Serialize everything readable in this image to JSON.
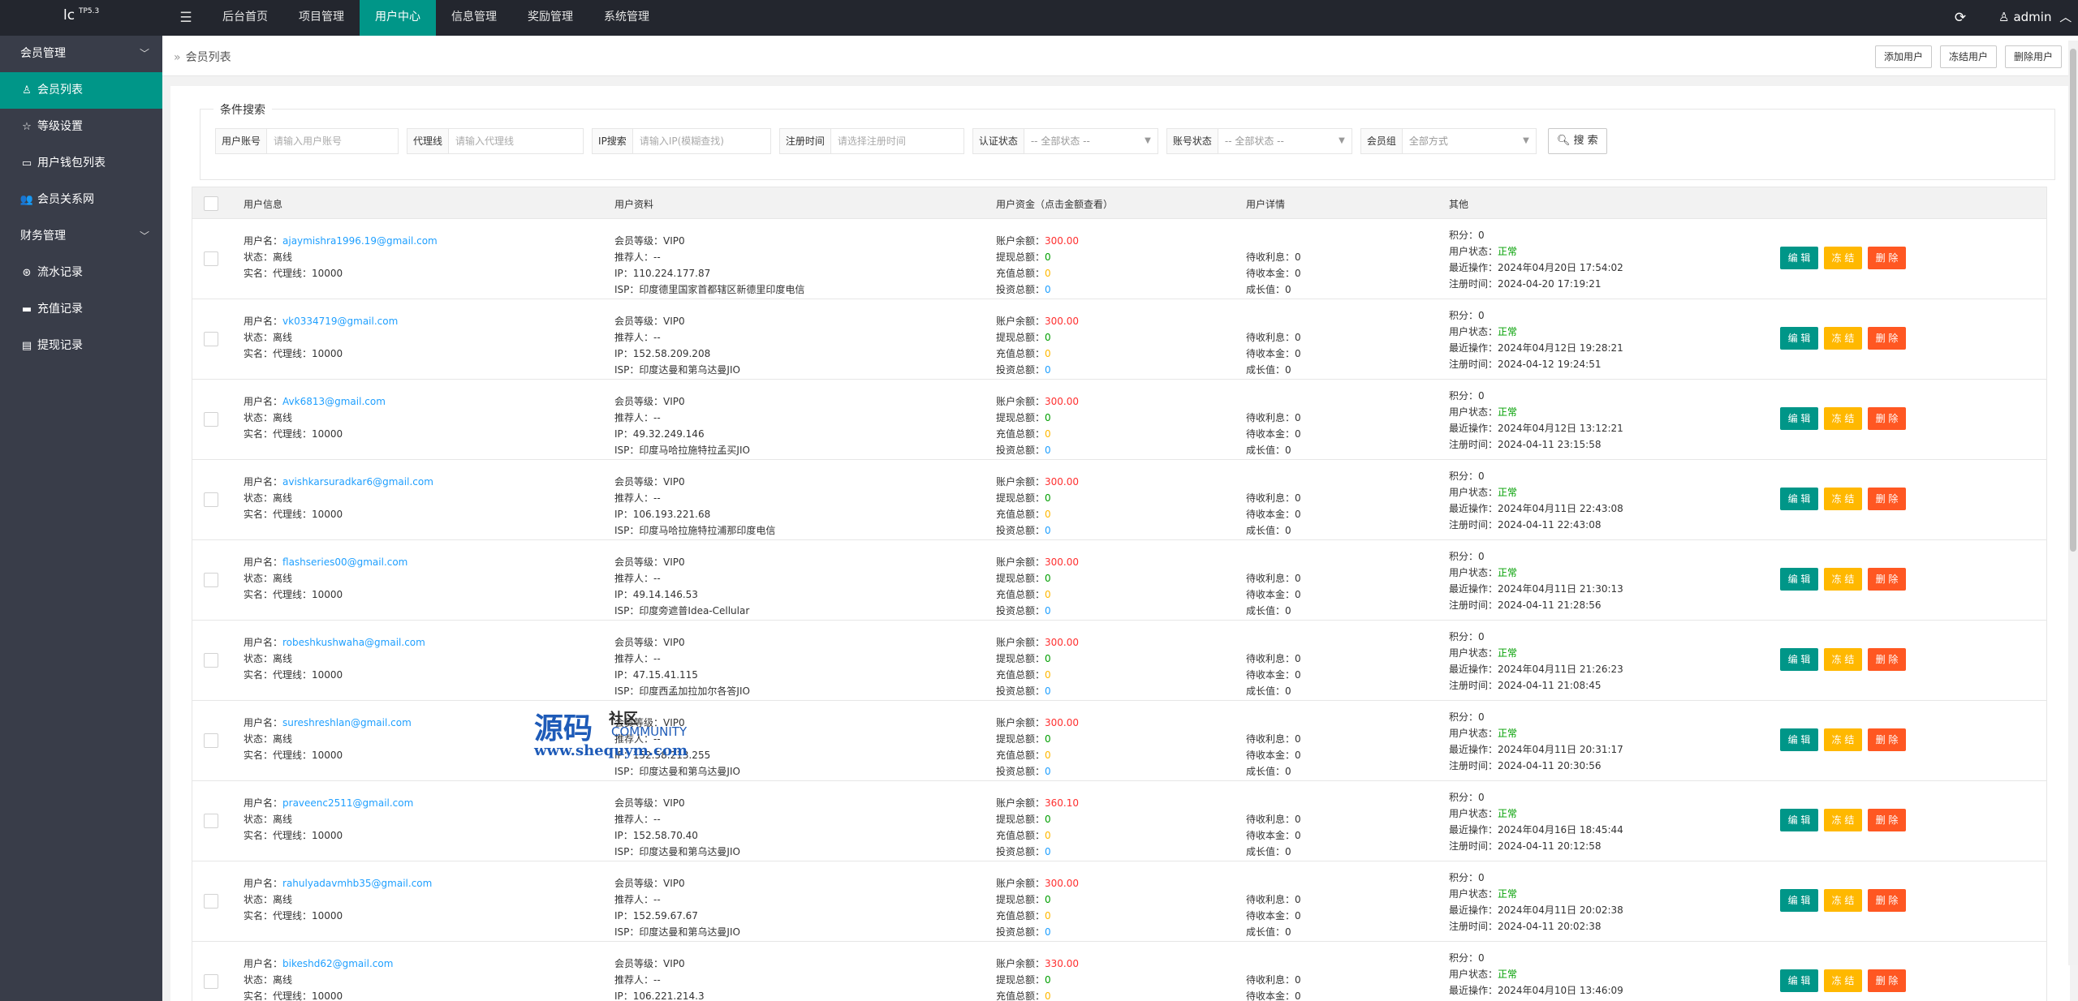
{
  "app": {
    "logo_main": "lc",
    "logo_sup": "TP5.3",
    "menu_toggle_icon": "hamburger-icon",
    "refresh_icon": "refresh-icon",
    "user": "admin"
  },
  "topnav": [
    {
      "label": "后台首页"
    },
    {
      "label": "项目管理"
    },
    {
      "label": "用户中心",
      "active": true
    },
    {
      "label": "信息管理"
    },
    {
      "label": "奖励管理"
    },
    {
      "label": "系统管理"
    }
  ],
  "sidebar": {
    "group1": "会员管理",
    "items1": [
      {
        "label": "会员列表",
        "icon": "user-icon",
        "glyph": "♙",
        "active": true
      },
      {
        "label": "等级设置",
        "icon": "star-icon",
        "glyph": "☆"
      },
      {
        "label": "用户钱包列表",
        "icon": "wallet-icon",
        "glyph": "▭"
      },
      {
        "label": "会员关系网",
        "icon": "users-icon",
        "glyph": "👥"
      }
    ],
    "group2": "财务管理",
    "items2": [
      {
        "label": "流水记录",
        "icon": "flow-icon",
        "glyph": "⊛"
      },
      {
        "label": "充值记录",
        "icon": "card-icon",
        "glyph": "▬"
      },
      {
        "label": "提现记录",
        "icon": "withdraw-icon",
        "glyph": "▤"
      }
    ]
  },
  "breadcrumb": {
    "sep": "»",
    "label": "会员列表"
  },
  "actions": {
    "add": "添加用户",
    "freeze": "冻结用户",
    "delete": "删除用户"
  },
  "search": {
    "legend": "条件搜索",
    "fields": [
      {
        "label": "用户账号",
        "placeholder": "请输入用户账号",
        "type": "input",
        "w": 162
      },
      {
        "label": "代理线",
        "placeholder": "请输入代理线",
        "type": "input",
        "w": 166
      },
      {
        "label": "IP搜索",
        "placeholder": "请输入IP(模糊查找)",
        "type": "input",
        "w": 170
      },
      {
        "label": "注册时间",
        "placeholder": "请选择注册时间",
        "type": "input",
        "w": 164
      },
      {
        "label": "认证状态",
        "placeholder": "-- 全部状态 --",
        "type": "select",
        "w": 165
      },
      {
        "label": "账号状态",
        "placeholder": "-- 全部状态 --",
        "type": "select",
        "w": 165
      },
      {
        "label": "会员组",
        "placeholder": "全部方式",
        "type": "select",
        "w": 165
      }
    ],
    "button": "搜 索"
  },
  "table": {
    "headers": [
      "用户信息",
      "用户资料",
      "用户资金（点击金额查看）",
      "用户详情",
      "其他"
    ],
    "labels": {
      "username": "用户名：",
      "status": "状态：",
      "realname": "实名：",
      "level": "会员等级：",
      "referrer": "推荐人：",
      "ip": "IP：",
      "isp": "ISP：",
      "balance": "账户余额：",
      "withdraw": "提现总额：",
      "recharge": "充值总额：",
      "invest": "投资总额：",
      "pend_interest": "待收利息：",
      "pend_principal": "待收本金：",
      "growth": "成长值：",
      "points": "积分：",
      "ustatus": "用户状态：",
      "lastop": "最近操作：",
      "regtime": "注册时间："
    },
    "btn_edit": "编 辑",
    "btn_freeze": "冻 结",
    "btn_delete": "删 除",
    "rows": [
      {
        "username": "ajaymishra1996.19@gmail.com",
        "status": "离线",
        "realname": "代理线：10000",
        "level": "VIP0",
        "referrer": "--",
        "ip": "110.224.177.87",
        "isp": "印度德里国家首都辖区新德里印度电信",
        "balance": "300.00",
        "withdraw": "0",
        "recharge": "0",
        "invest": "0",
        "pend_interest": "0",
        "pend_principal": "0",
        "growth": "0",
        "points": "0",
        "ustatus": "正常",
        "lastop": "2024年04月20日 17:54:02",
        "regtime": "2024-04-20 17:19:21"
      },
      {
        "username": "vk0334719@gmail.com",
        "status": "离线",
        "realname": "代理线：10000",
        "level": "VIP0",
        "referrer": "--",
        "ip": "152.58.209.208",
        "isp": "印度达曼和第乌达曼JIO",
        "balance": "300.00",
        "withdraw": "0",
        "recharge": "0",
        "invest": "0",
        "pend_interest": "0",
        "pend_principal": "0",
        "growth": "0",
        "points": "0",
        "ustatus": "正常",
        "lastop": "2024年04月12日 19:28:21",
        "regtime": "2024-04-12 19:24:51"
      },
      {
        "username": "Avk6813@gmail.com",
        "status": "离线",
        "realname": "代理线：10000",
        "level": "VIP0",
        "referrer": "--",
        "ip": "49.32.249.146",
        "isp": "印度马哈拉施特拉孟买JIO",
        "balance": "300.00",
        "withdraw": "0",
        "recharge": "0",
        "invest": "0",
        "pend_interest": "0",
        "pend_principal": "0",
        "growth": "0",
        "points": "0",
        "ustatus": "正常",
        "lastop": "2024年04月12日 13:12:21",
        "regtime": "2024-04-11 23:15:58"
      },
      {
        "username": "avishkarsuradkar6@gmail.com",
        "status": "离线",
        "realname": "代理线：10000",
        "level": "VIP0",
        "referrer": "--",
        "ip": "106.193.221.68",
        "isp": "印度马哈拉施特拉浦那印度电信",
        "balance": "300.00",
        "withdraw": "0",
        "recharge": "0",
        "invest": "0",
        "pend_interest": "0",
        "pend_principal": "0",
        "growth": "0",
        "points": "0",
        "ustatus": "正常",
        "lastop": "2024年04月11日 22:43:08",
        "regtime": "2024-04-11 22:43:08"
      },
      {
        "username": "flashseries00@gmail.com",
        "status": "离线",
        "realname": "代理线：10000",
        "level": "VIP0",
        "referrer": "--",
        "ip": "49.14.146.53",
        "isp": "印度旁遮普Idea-Cellular",
        "balance": "300.00",
        "withdraw": "0",
        "recharge": "0",
        "invest": "0",
        "pend_interest": "0",
        "pend_principal": "0",
        "growth": "0",
        "points": "0",
        "ustatus": "正常",
        "lastop": "2024年04月11日 21:30:13",
        "regtime": "2024-04-11 21:28:56"
      },
      {
        "username": "robeshkushwaha@gmail.com",
        "status": "离线",
        "realname": "代理线：10000",
        "level": "VIP0",
        "referrer": "--",
        "ip": "47.15.41.115",
        "isp": "印度西孟加拉加尔各答JIO",
        "balance": "300.00",
        "withdraw": "0",
        "recharge": "0",
        "invest": "0",
        "pend_interest": "0",
        "pend_principal": "0",
        "growth": "0",
        "points": "0",
        "ustatus": "正常",
        "lastop": "2024年04月11日 21:26:23",
        "regtime": "2024-04-11 21:08:45"
      },
      {
        "username": "sureshreshlan@gmail.com",
        "status": "离线",
        "realname": "代理线：10000",
        "level": "VIP0",
        "referrer": "--",
        "ip": "152.58.213.255",
        "isp": "印度达曼和第乌达曼JIO",
        "balance": "300.00",
        "withdraw": "0",
        "recharge": "0",
        "invest": "0",
        "pend_interest": "0",
        "pend_principal": "0",
        "growth": "0",
        "points": "0",
        "ustatus": "正常",
        "lastop": "2024年04月11日 20:31:17",
        "regtime": "2024-04-11 20:30:56"
      },
      {
        "username": "praveenc2511@gmail.com",
        "status": "离线",
        "realname": "代理线：10000",
        "level": "VIP0",
        "referrer": "--",
        "ip": "152.58.70.40",
        "isp": "印度达曼和第乌达曼JIO",
        "balance": "360.10",
        "withdraw": "0",
        "recharge": "0",
        "invest": "0",
        "pend_interest": "0",
        "pend_principal": "0",
        "growth": "0",
        "points": "0",
        "ustatus": "正常",
        "lastop": "2024年04月16日 18:45:44",
        "regtime": "2024-04-11 20:12:58"
      },
      {
        "username": "rahulyadavmhb35@gmail.com",
        "status": "离线",
        "realname": "代理线：10000",
        "level": "VIP0",
        "referrer": "--",
        "ip": "152.59.67.67",
        "isp": "印度达曼和第乌达曼JIO",
        "balance": "300.00",
        "withdraw": "0",
        "recharge": "0",
        "invest": "0",
        "pend_interest": "0",
        "pend_principal": "0",
        "growth": "0",
        "points": "0",
        "ustatus": "正常",
        "lastop": "2024年04月11日 20:02:38",
        "regtime": "2024-04-11 20:02:38"
      },
      {
        "username": "bikeshd62@gmail.com",
        "status": "离线",
        "realname": "代理线：10000",
        "level": "VIP0",
        "referrer": "--",
        "ip": "106.221.214.3",
        "isp": "",
        "balance": "330.00",
        "withdraw": "0",
        "recharge": "0",
        "invest": "0",
        "pend_interest": "0",
        "pend_principal": "0",
        "growth": "0",
        "points": "0",
        "ustatus": "正常",
        "lastop": "2024年04月10日 13:46:09",
        "regtime": ""
      }
    ]
  },
  "watermark": {
    "big": "源码",
    "small": "社区",
    "en": "COMMUNITY",
    "url": "www.shequym.com"
  }
}
